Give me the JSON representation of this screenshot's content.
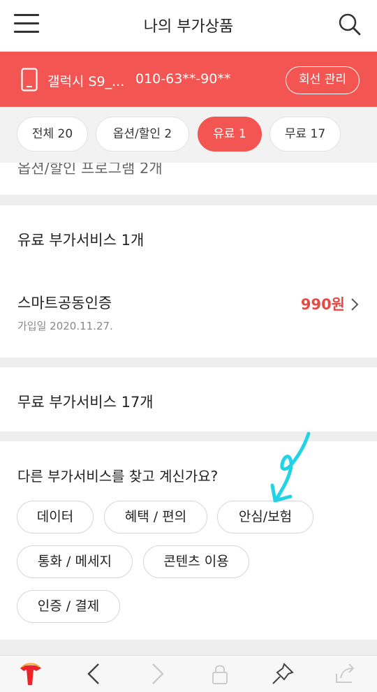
{
  "header": {
    "title": "나의 부가상품"
  },
  "line": {
    "device": "갤럭시 S9_...",
    "number": "010-63**-90**",
    "manage_label": "회선 관리"
  },
  "filters": [
    {
      "label": "전체 20",
      "active": false
    },
    {
      "label": "옵션/할인 2",
      "active": false
    },
    {
      "label": "유료 1",
      "active": true
    },
    {
      "label": "무료 17",
      "active": false
    }
  ],
  "peek_text": "옵션/할인 프로그램 2개",
  "paid": {
    "title": "유료 부가서비스 1개",
    "items": [
      {
        "name": "스마트공동인증",
        "date": "가입일 2020.11.27.",
        "price": "990원"
      }
    ]
  },
  "free": {
    "title": "무료 부가서비스 17개"
  },
  "discover": {
    "title": "다른 부가서비스를 찾고 계신가요?",
    "tags": [
      "데이터",
      "혜택 / 편의",
      "안심/보험",
      "통화 / 메세지",
      "콘텐츠 이용",
      "인증 / 결제"
    ]
  },
  "colors": {
    "accent": "#f25552",
    "price": "#e34b45",
    "annotation": "#22d3e6"
  },
  "bottom_nav": [
    "t-logo-icon",
    "back-icon",
    "forward-icon",
    "lock-icon",
    "pin-icon",
    "share-icon"
  ]
}
